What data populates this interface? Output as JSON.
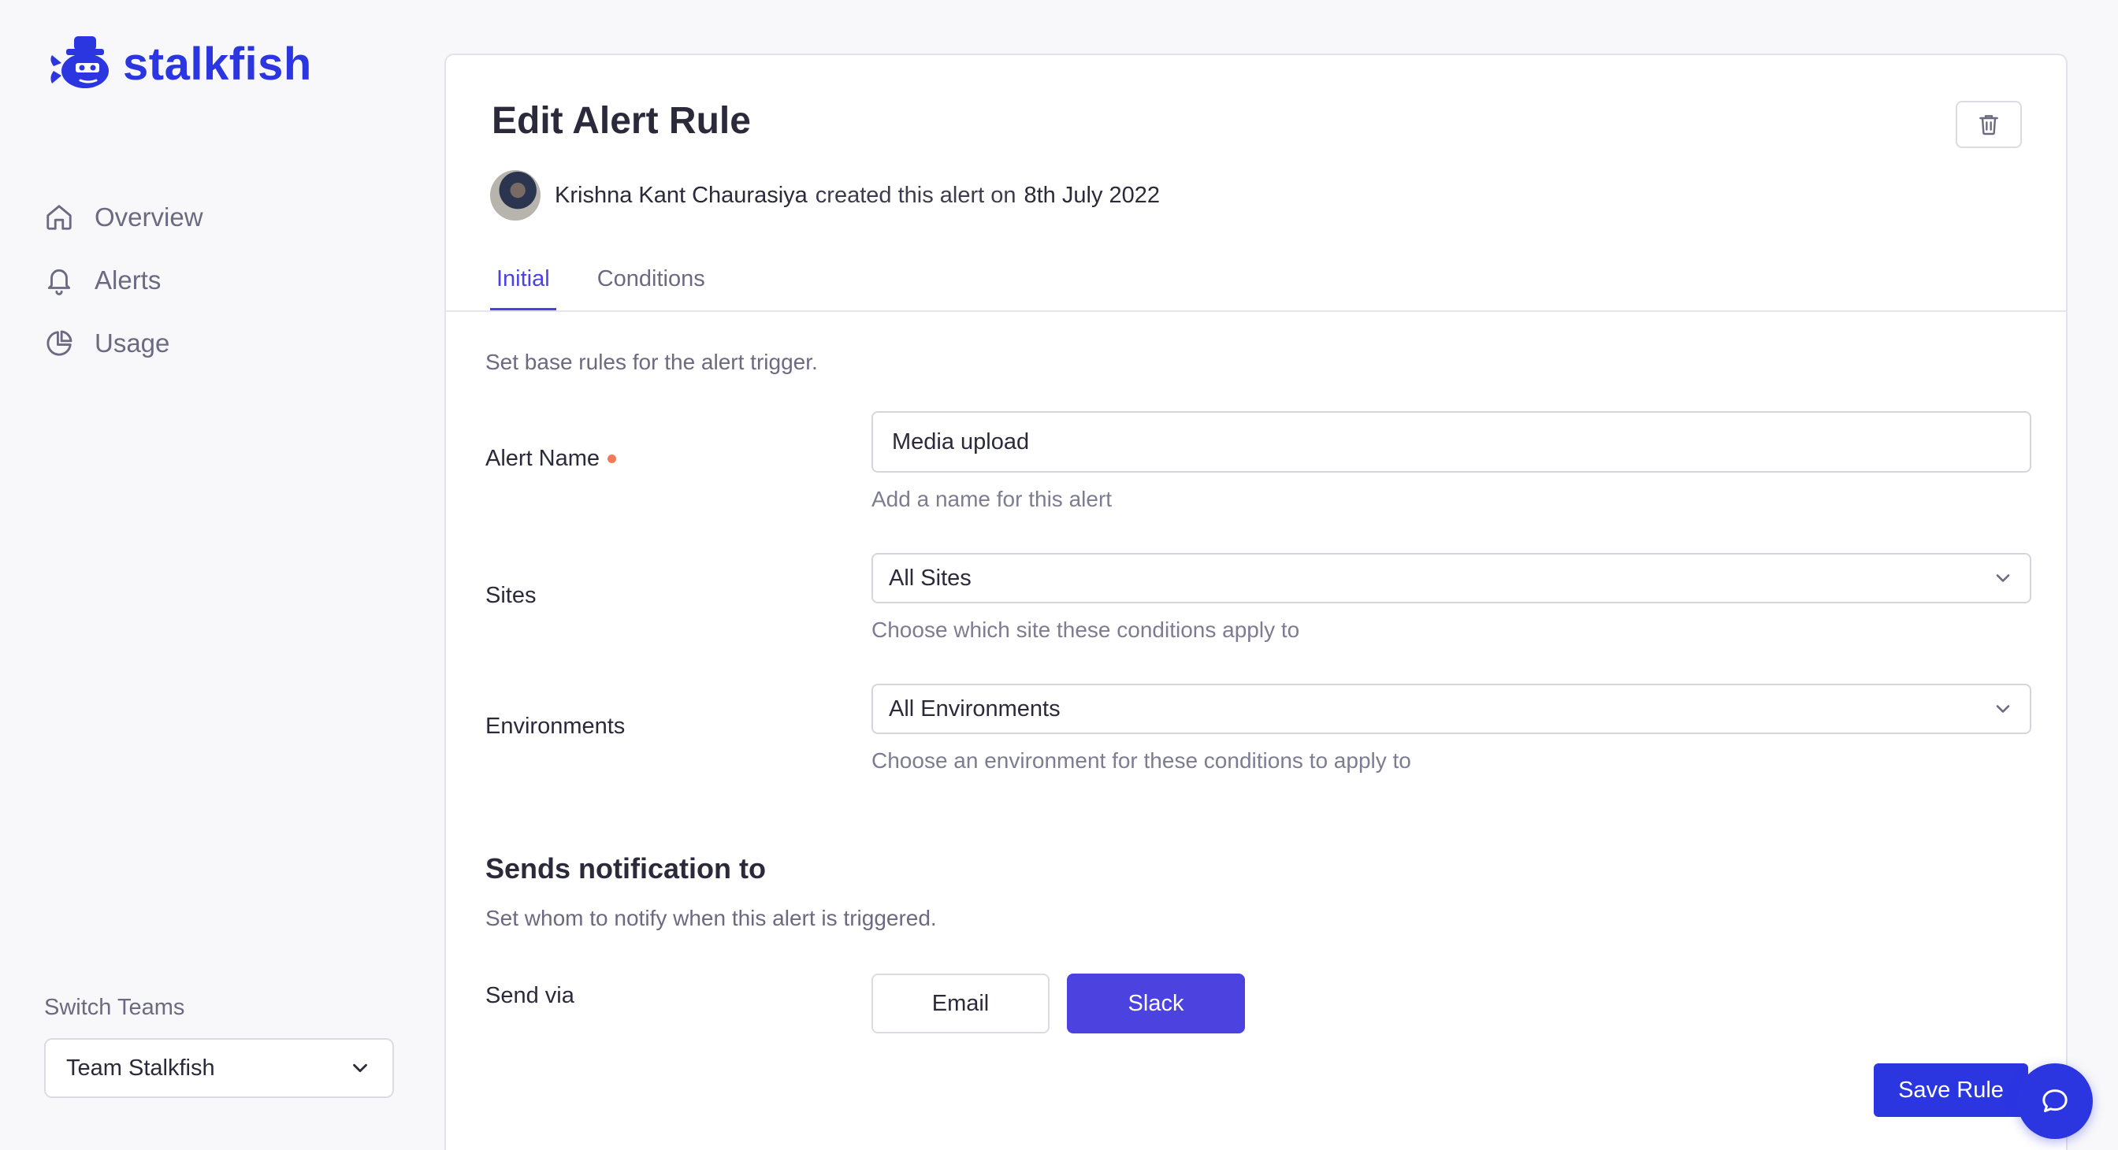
{
  "brand": {
    "name": "stalkfish",
    "color": "#2b35e0"
  },
  "sidebar": {
    "items": [
      {
        "label": "Overview",
        "icon": "home-icon"
      },
      {
        "label": "Alerts",
        "icon": "bell-icon"
      },
      {
        "label": "Usage",
        "icon": "pie-chart-icon"
      }
    ],
    "switch_teams_label": "Switch Teams",
    "team_selected": "Team Stalkfish"
  },
  "header": {
    "title": "Edit Alert Rule",
    "creator": "Krishna Kant Chaurasiya",
    "created_text": "created this alert on",
    "created_date": "8th July 2022"
  },
  "tabs": [
    {
      "label": "Initial",
      "active": true
    },
    {
      "label": "Conditions",
      "active": false
    }
  ],
  "form": {
    "intro": "Set base rules for the alert trigger.",
    "alert_name": {
      "label": "Alert Name",
      "value": "Media upload",
      "help": "Add a name for this alert"
    },
    "sites": {
      "label": "Sites",
      "value": "All Sites",
      "help": "Choose which site these conditions apply to"
    },
    "environments": {
      "label": "Environments",
      "value": "All Environments",
      "help": "Choose an environment for these conditions to apply to"
    }
  },
  "notifications": {
    "title": "Sends notification to",
    "desc": "Set whom to notify when this alert is triggered.",
    "send_via_label": "Send via",
    "email_label": "Email",
    "slack_label": "Slack"
  },
  "actions": {
    "save_label": "Save Rule"
  },
  "colors": {
    "accent": "#4b42e0",
    "required": "#f37a52"
  }
}
